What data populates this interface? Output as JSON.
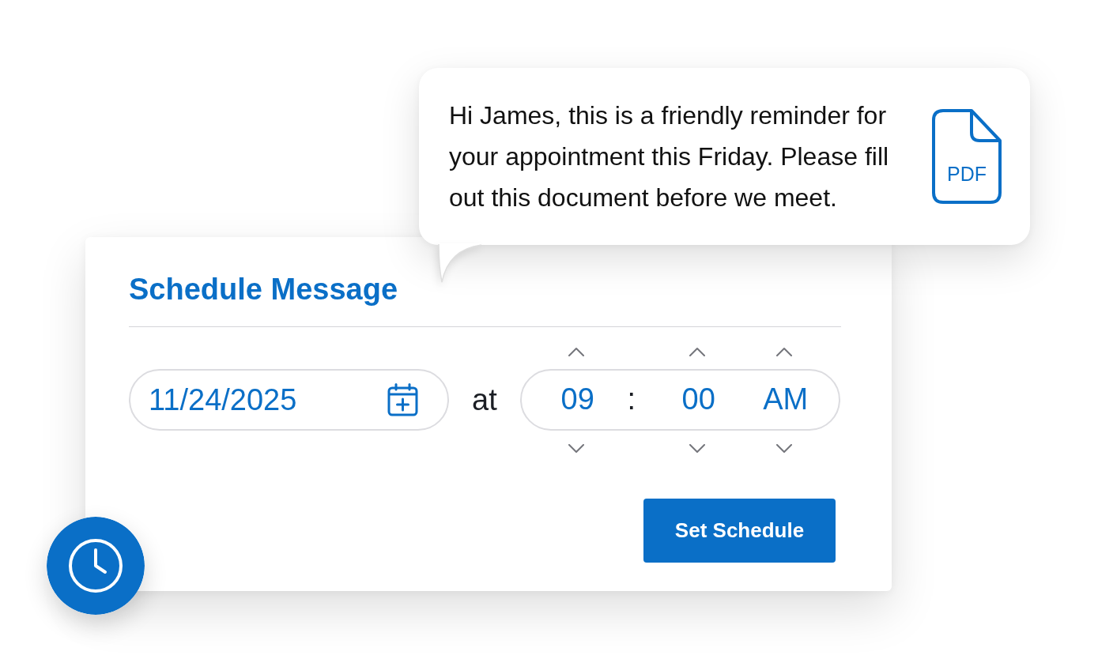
{
  "message_bubble": {
    "text": "Hi James, this is a friendly reminder for your appointment this Friday. Please fill out this document before we meet.",
    "attachment": {
      "label": "PDF"
    }
  },
  "schedule_card": {
    "title": "Schedule Message",
    "date_field": {
      "value": "11/24/2025"
    },
    "separator": "at",
    "time_field": {
      "segments": [
        {
          "kind": "number",
          "value": "09"
        },
        {
          "kind": "separator",
          "value": ":"
        },
        {
          "kind": "number",
          "value": "00"
        },
        {
          "kind": "period",
          "value": "AM"
        }
      ]
    },
    "button": "Set Schedule"
  }
}
